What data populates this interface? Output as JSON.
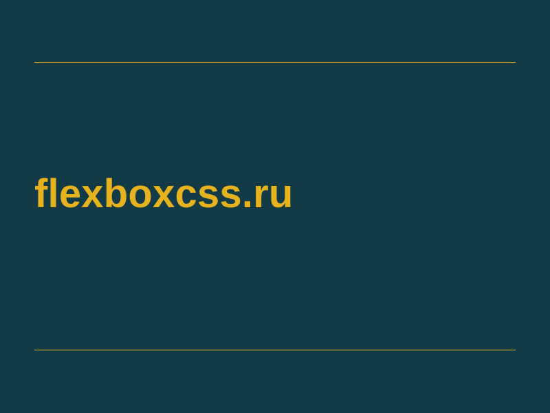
{
  "title": "flexboxcss.ru"
}
